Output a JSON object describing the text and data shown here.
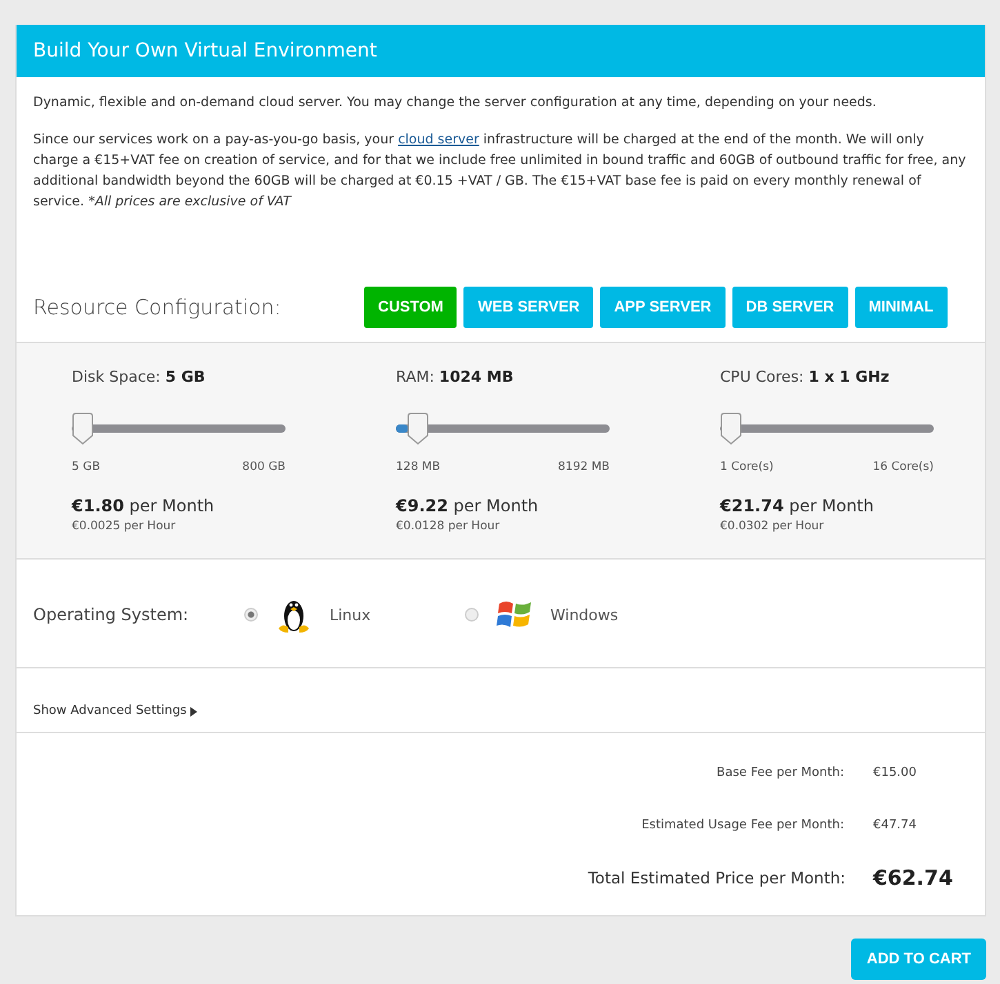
{
  "panel": {
    "title": "Build Your Own Virtual Environment"
  },
  "intro": {
    "lead": "Dynamic, flexible and on-demand cloud server. You may change the server configuration at any time, depending on your needs.",
    "before": "Since our services work on a pay-as-you-go basis, your",
    "link": "cloud server",
    "after": "infrastructure will be charged at the end of the month. We will only charge a €15+VAT fee on creation of service, and for that we include free unlimited in bound traffic and 60GB of outbound traffic for free, any additional bandwidth beyond the 60GB will be charged at €0.15 +VAT / GB. The €15+VAT base fee is paid on every monthly renewal of service.",
    "note": "*All prices are exclusive of VAT"
  },
  "config": {
    "label": "Resource Configuration:",
    "presets": [
      {
        "label": "CUSTOM",
        "selected": true
      },
      {
        "label": "WEB SERVER",
        "selected": false
      },
      {
        "label": "APP SERVER",
        "selected": false
      },
      {
        "label": "DB SERVER",
        "selected": false
      },
      {
        "label": "MINIMAL",
        "selected": false
      }
    ]
  },
  "resources": [
    {
      "name": "Disk Space:",
      "value": "5 GB",
      "level": 0,
      "min": "5 GB",
      "max": "800 GB",
      "monthly": "€1.80",
      "monthly_unit": "per Month",
      "hourly": "€0.0025 per Hour"
    },
    {
      "name": "RAM:",
      "value": "1024 MB",
      "level": 0.06,
      "min": "128 MB",
      "max": "8192 MB",
      "monthly": "€9.22",
      "monthly_unit": "per Month",
      "hourly": "€0.0128 per Hour"
    },
    {
      "name": "CPU Cores:",
      "value": "1 x 1 GHz",
      "level": 0,
      "min": "1 Core(s)",
      "max": "16 Core(s)",
      "monthly": "€21.74",
      "monthly_unit": "per Month",
      "hourly": "€0.0302 per Hour"
    }
  ],
  "os": {
    "label": "Operating System:",
    "options": [
      {
        "kind": "linux",
        "label": "Linux",
        "selected": true
      },
      {
        "kind": "windows",
        "label": "Windows",
        "selected": false
      }
    ]
  },
  "advanced": {
    "label": "Show Advanced Settings",
    "expanded": false
  },
  "totals": [
    {
      "kind": "line",
      "label": "Base Fee per Month:",
      "value": "€15.00"
    },
    {
      "kind": "line",
      "label": "Estimated Usage Fee per Month:",
      "value": "€47.74"
    },
    {
      "kind": "total",
      "label": "Total Estimated Price per Month:",
      "value": "€62.74"
    }
  ],
  "cart_button": "ADD TO CART"
}
